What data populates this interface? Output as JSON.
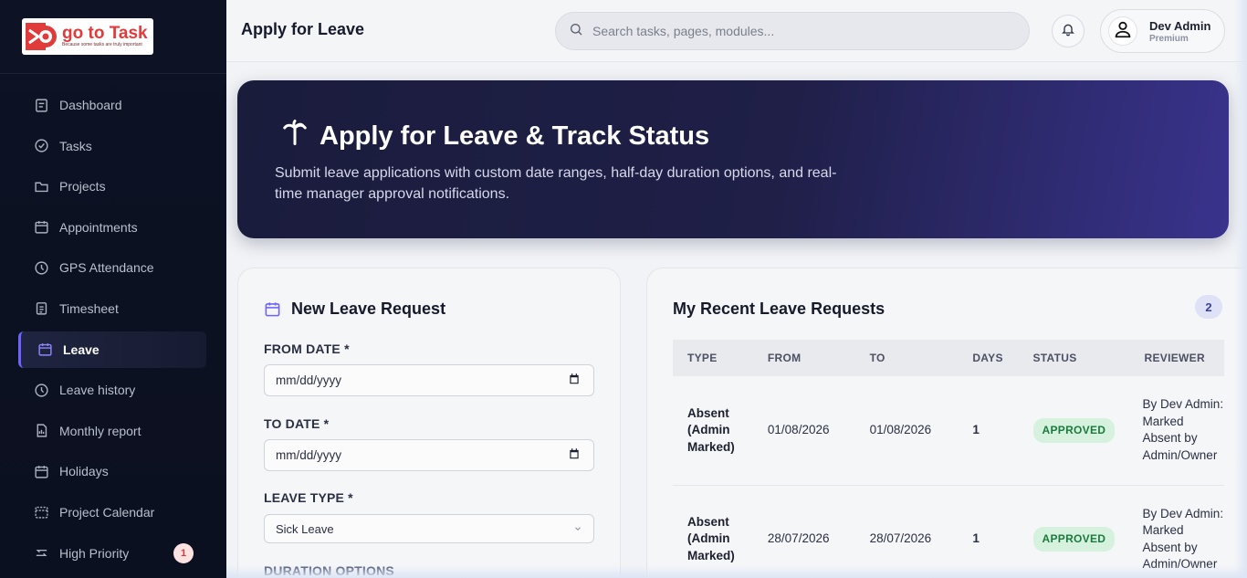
{
  "app": {
    "logo_title": "go to Task",
    "logo_tagline": "Because some tasks are truly important",
    "brand_color": "#e03a3a"
  },
  "sidebar": {
    "items": [
      {
        "label": "Dashboard",
        "icon": "dashboard-icon"
      },
      {
        "label": "Tasks",
        "icon": "check-circle-icon"
      },
      {
        "label": "Projects",
        "icon": "folder-icon"
      },
      {
        "label": "Appointments",
        "icon": "calendar-icon"
      },
      {
        "label": "GPS Attendance",
        "icon": "clock-icon"
      },
      {
        "label": "Timesheet",
        "icon": "clipboard-icon"
      },
      {
        "label": "Leave",
        "icon": "calendar-icon",
        "active": true
      },
      {
        "label": "Leave history",
        "icon": "clock-icon"
      },
      {
        "label": "Monthly report",
        "icon": "report-icon"
      },
      {
        "label": "Holidays",
        "icon": "calendar-icon"
      },
      {
        "label": "Project Calendar",
        "icon": "calendar-dashed-icon"
      },
      {
        "label": "High Priority",
        "icon": "arrows-icon",
        "badge": "1"
      }
    ],
    "active_color": "#6d63ff"
  },
  "header": {
    "title": "Apply for Leave",
    "search_placeholder": "Search tasks, pages, modules...",
    "user_name": "Dev Admin",
    "user_plan": "Premium"
  },
  "hero": {
    "title": "Apply for Leave & Track Status",
    "description": "Submit leave applications with custom date ranges, half-day duration options, and real-time manager approval notifications.",
    "icon": "palm-tree-icon"
  },
  "form": {
    "title": "New Leave Request",
    "from_label": "FROM DATE *",
    "from_value": "mm/dd/yyyy",
    "to_label": "TO DATE *",
    "to_value": "mm/dd/yyyy",
    "type_label": "LEAVE TYPE *",
    "type_value": "Sick Leave",
    "duration_label": "DURATION OPTIONS"
  },
  "requests": {
    "title": "My Recent Leave Requests",
    "count": "2",
    "columns": [
      "TYPE",
      "FROM",
      "TO",
      "DAYS",
      "STATUS",
      "REVIEWER"
    ],
    "rows": [
      {
        "type": "Absent (Admin Marked)",
        "from": "01/08/2026",
        "to": "01/08/2026",
        "days": "1",
        "status": "APPROVED",
        "reviewer": "By Dev Admin: Marked Absent by Admin/Owner"
      },
      {
        "type": "Absent (Admin Marked)",
        "from": "28/07/2026",
        "to": "28/07/2026",
        "days": "1",
        "status": "APPROVED",
        "reviewer": "By Dev Admin: Marked Absent by Admin/Owner"
      }
    ],
    "status_color": "#1b7a3d"
  }
}
